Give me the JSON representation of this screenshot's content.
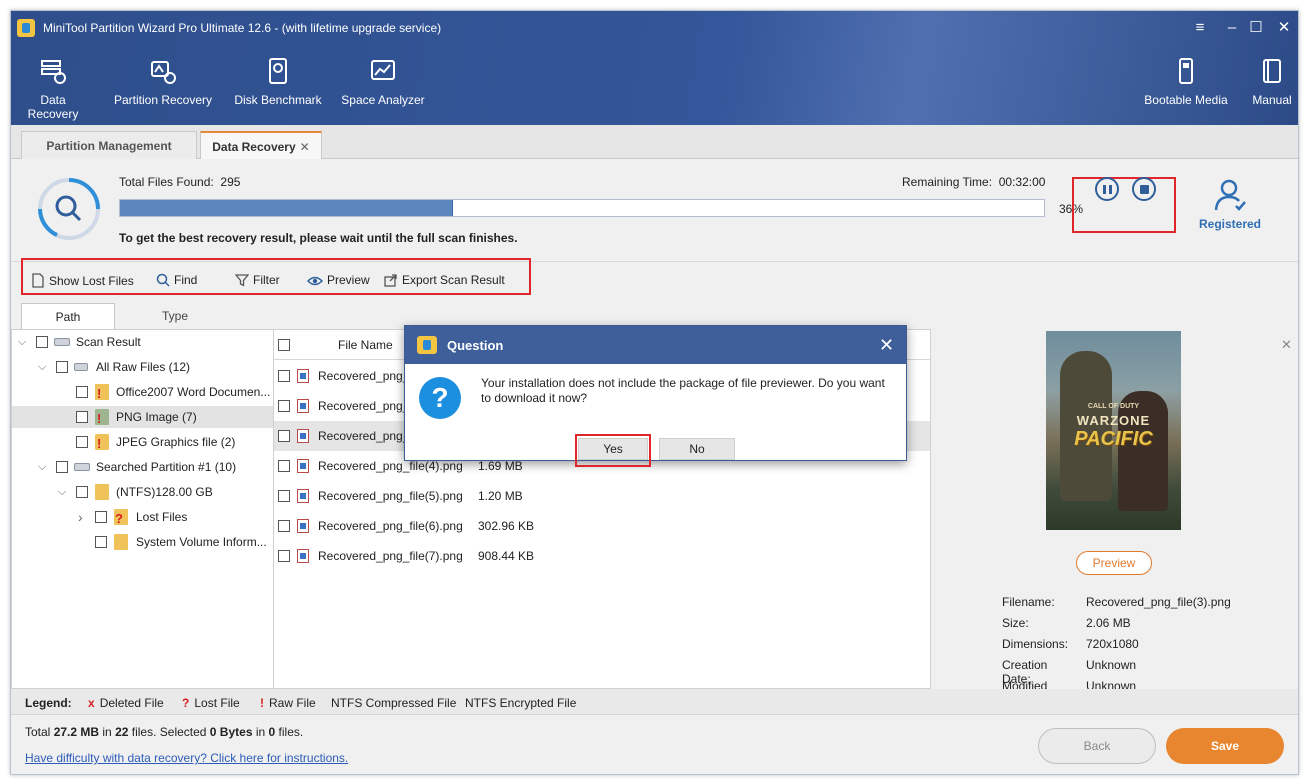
{
  "window": {
    "title": "MiniTool Partition Wizard Pro Ultimate 12.6 - (with lifetime upgrade service)",
    "controls": {
      "menu": "≡",
      "minimize": "–",
      "maximize": "☐",
      "close": "✕"
    }
  },
  "toolbar": {
    "data_recovery": "Data Recovery",
    "partition_recovery": "Partition Recovery",
    "disk_benchmark": "Disk Benchmark",
    "space_analyzer": "Space Analyzer",
    "bootable_media": "Bootable Media",
    "manual": "Manual"
  },
  "tabs": {
    "partition_management": "Partition Management",
    "data_recovery": "Data Recovery",
    "close_glyph": "✕"
  },
  "scan": {
    "files_found_label": "Total Files Found:",
    "files_found_value": "295",
    "remaining_label": "Remaining Time:",
    "remaining_value": "00:32:00",
    "progress": 36,
    "progress_text": "36%",
    "note": "To get the best recovery result, please wait until the full scan finishes.",
    "registered": "Registered"
  },
  "actions": {
    "show_lost_files": "Show Lost Files",
    "find": "Find",
    "filter": "Filter",
    "preview": "Preview",
    "export": "Export Scan Result"
  },
  "subtabs": {
    "path": "Path",
    "type": "Type"
  },
  "tree": {
    "scan_result": "Scan Result",
    "all_raw": "All Raw Files (12)",
    "office": "Office2007 Word Documen...",
    "png": "PNG Image (7)",
    "jpeg": "JPEG Graphics file (2)",
    "searched": "Searched Partition #1 (10)",
    "ntfs": "(NTFS)128.00 GB",
    "lost": "Lost Files",
    "svi": "System Volume Inform...",
    "chev_down": "⌵",
    "chev_right": "›"
  },
  "files": {
    "col_name": "File Name",
    "rows": [
      {
        "name": "Recovered_png_",
        "size": ""
      },
      {
        "name": "Recovered_png_",
        "size": ""
      },
      {
        "name": "Recovered_png_",
        "size": ""
      },
      {
        "name": "Recovered_png_file(4).png",
        "size": "1.69 MB"
      },
      {
        "name": "Recovered_png_file(5).png",
        "size": "1.20 MB"
      },
      {
        "name": "Recovered_png_file(6).png",
        "size": "302.96 KB"
      },
      {
        "name": "Recovered_png_file(7).png",
        "size": "908.44 KB"
      }
    ]
  },
  "preview": {
    "close": "✕",
    "poster_line1": "CALL OF DUTY",
    "poster_line2": "WARZONE",
    "poster_line3": "PACIFIC",
    "button": "Preview",
    "filename_k": "Filename:",
    "filename_v": "Recovered_png_file(3).png",
    "size_k": "Size:",
    "size_v": "2.06 MB",
    "dims_k": "Dimensions:",
    "dims_v": "720x1080",
    "created_k": "Creation Date:",
    "created_v": "Unknown",
    "modified_k": "Modified Date:",
    "modified_v": "Unknown"
  },
  "legend": {
    "label": "Legend:",
    "deleted_mark": "x",
    "deleted": "Deleted File",
    "lost_mark": "?",
    "lost": "Lost File",
    "raw_mark": "!",
    "raw": "Raw File",
    "compressed": "NTFS Compressed File",
    "encrypted": "NTFS Encrypted File"
  },
  "bottom": {
    "t1": "Total ",
    "t2": "27.2 MB",
    "t3": " in ",
    "t4": "22",
    "t5": " files.  Selected ",
    "t6": "0 Bytes",
    "t7": " in ",
    "t8": "0",
    "t9": " files.",
    "help": "Have difficulty with data recovery? Click here for instructions.",
    "back": "Back",
    "save": "Save"
  },
  "dialog": {
    "title": "Question",
    "close": "✕",
    "q": "?",
    "message": "Your installation does not include the package of file previewer. Do you want to download it now?",
    "yes": "Yes",
    "no": "No"
  },
  "colors": {
    "accent": "#e8852f",
    "header": "#34569a",
    "highlight": "#e0262a"
  }
}
